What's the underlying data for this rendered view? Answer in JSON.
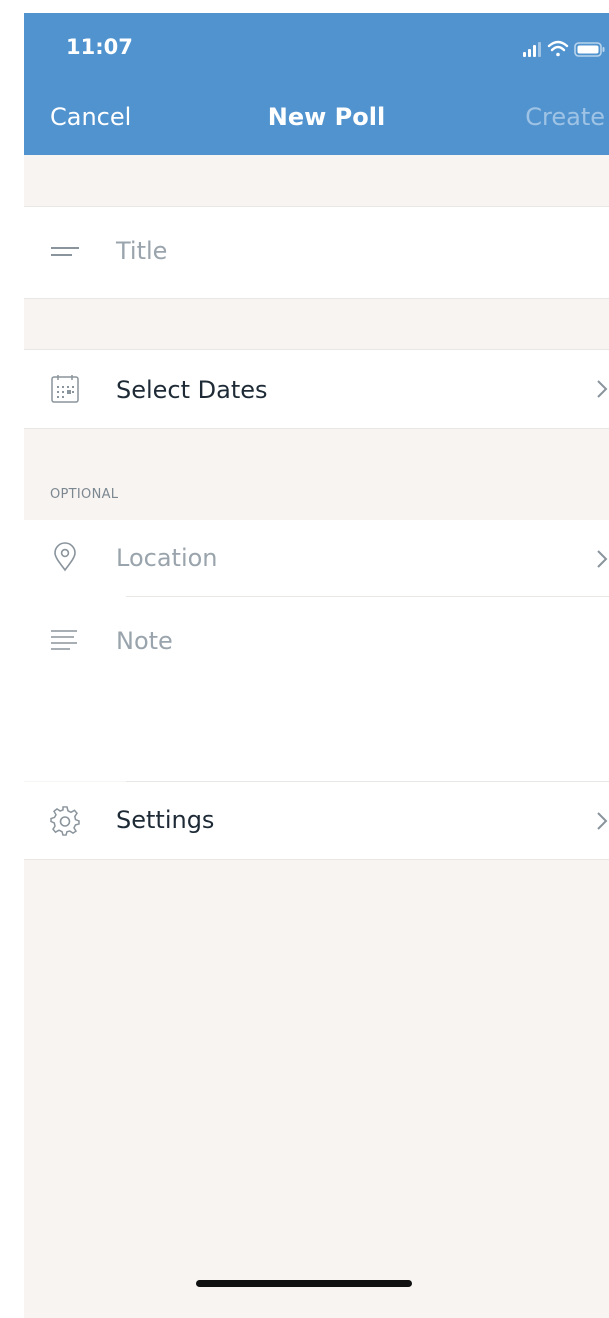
{
  "status_bar": {
    "time": "11:07",
    "icons": [
      "signal-icon",
      "wifi-icon",
      "battery-icon"
    ]
  },
  "navbar": {
    "cancel_label": "Cancel",
    "title": "New Poll",
    "create_label": "Create",
    "background_color": "#5093cf"
  },
  "form": {
    "title_placeholder": "Title",
    "select_dates_label": "Select Dates",
    "optional_section_label": "OPTIONAL",
    "location_placeholder": "Location",
    "note_placeholder": "Note",
    "settings_label": "Settings"
  },
  "colors": {
    "background": "#f7f4f2",
    "text": "#1e2b36",
    "placeholder": "#9aa4ac"
  }
}
